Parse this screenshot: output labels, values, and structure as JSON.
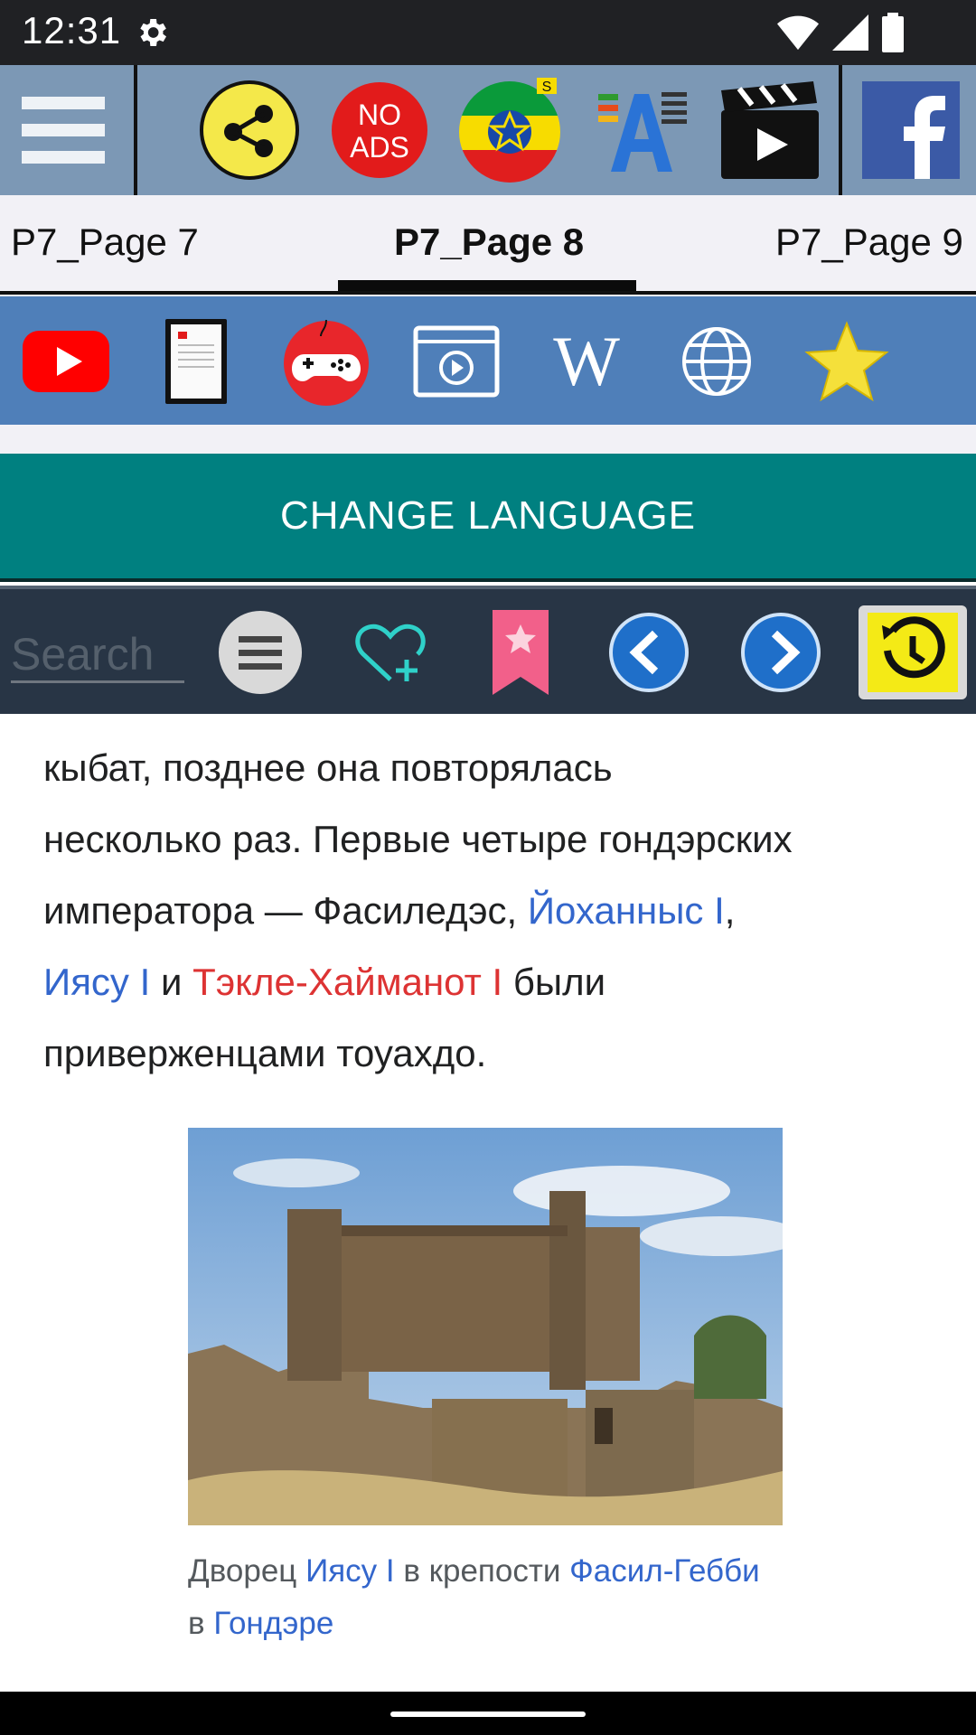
{
  "status": {
    "time": "12:31",
    "icons": [
      "settings-icon",
      "wifi-icon",
      "signal-icon",
      "battery-icon"
    ]
  },
  "toolbar": {
    "buttons": [
      "menu-icon",
      "share-icon",
      "no-ads-icon",
      "ethiopia-flag-icon",
      "font-size-icon",
      "video-icon",
      "facebook-icon"
    ],
    "no_ads_label_line1": "NO",
    "no_ads_label_line2": "ADS",
    "flag_badge": "S"
  },
  "tabs": {
    "items": [
      {
        "label": "P7_Page 7",
        "active": false
      },
      {
        "label": "P7_Page 8",
        "active": true
      },
      {
        "label": "P7_Page 9",
        "active": false
      }
    ]
  },
  "quick_links": [
    "youtube-icon",
    "ebook-icon",
    "gamepad-icon",
    "video-player-icon",
    "wikipedia-icon",
    "globe-icon",
    "star-icon"
  ],
  "wikipedia_label": "W",
  "change_language": "CHANGE LANGUAGE",
  "navbar": {
    "search_placeholder": "Search",
    "buttons": [
      "list-icon",
      "add-favorite-icon",
      "bookmark-icon",
      "back-icon",
      "forward-icon",
      "history-icon"
    ]
  },
  "article": {
    "line1": "кыбат, позднее она повторялась",
    "line2": "несколько раз. Первые четыре гондэрских",
    "line3_prefix": "императора — Фасиледэс, ",
    "line3_link": "Йоханныс I",
    "line3_suffix": ",",
    "line4_link": "Иясу I",
    "line4_mid": " и ",
    "line4_red": "Тэкле-Хайманот I",
    "line4_suffix": " были",
    "line5": "приверженцами тоуахдо."
  },
  "caption": {
    "prefix": "Дворец ",
    "link1": "Иясу I",
    "mid": " в крепости ",
    "link2": "Фасил-Гебби",
    "mid2": " в ",
    "link3": "Гондэре"
  },
  "colors": {
    "toolbar_bg": "#7c98b5",
    "quick_bg": "#4f7fb9",
    "change_lang_bg": "#008080",
    "navbar_bg": "#283545",
    "link": "#3366cc",
    "red_link": "#dd3333"
  }
}
